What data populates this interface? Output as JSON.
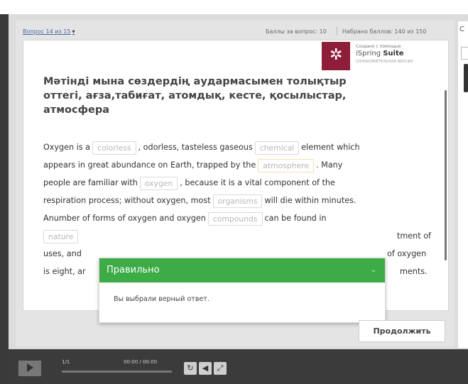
{
  "header": {
    "question_indicator": "Вопрос 14 из 15",
    "points_per_question": "Баллы за вопрос: 10",
    "points_total": "Набрано баллов: 140 из 150"
  },
  "watermark": {
    "line1": "Создано с помощью",
    "line2_a": "iSpring ",
    "line2_b": "Suite",
    "line3": "ОЗНАКОМИТЕЛЬНАЯ ВЕРСИЯ"
  },
  "question": {
    "title": "Мәтінді мына сөздердің аудармасымен толықтыр оттегі, ағза,табиғат, атомдық, кесте, қосылыстар, атмосфера"
  },
  "passage": {
    "l1a": "Oxygen is a",
    "g1": "colorless",
    "l1b": ", odorless, tasteless gaseous",
    "g2": "chemical",
    "l1c": "element which",
    "l2a": "appears in great abundance on Earth, trapped by the",
    "g3": "atmosphere",
    "l2b": ". Many",
    "l3a": "people are familiar with",
    "g4": "oxygen",
    "l3b": ", because it is a vital component of the",
    "l4a": "respiration process; without oxygen, most",
    "g5": "organisms",
    "l4b": "will die within minutes.",
    "l5a": "Anumber of forms of oxygen and oxygen",
    "g6": "compounds",
    "l5b": "can be found in",
    "g7": "nature",
    "l6_tail": "tment of",
    "l7a": "uses, and",
    "l7_tail": "of oxygen",
    "l8a": "is eight, ar",
    "l8_tail": "ments."
  },
  "feedback": {
    "title": "Правильно",
    "chevron": "⌄",
    "message": "Вы выбрали верный ответ."
  },
  "continue_label": "Продолжить",
  "player": {
    "slide_count": "1/1",
    "time": "00:00 / 00:00"
  },
  "colors": {
    "correct_green": "#3eac46",
    "watermark_logo": "#8e1d3a"
  }
}
